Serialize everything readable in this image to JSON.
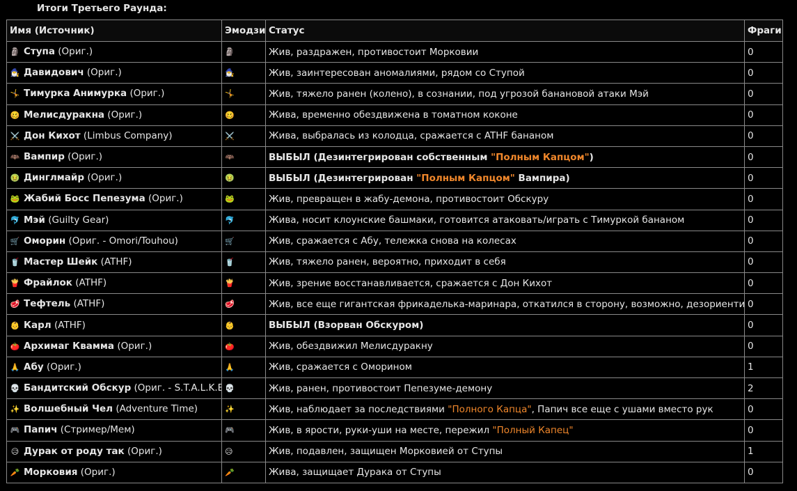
{
  "title": "Итоги Третьего Раунда:",
  "colors": {
    "highlight": "#f0872b",
    "border": "#8a8a8a",
    "background": "#000000",
    "text": "#e6e6e6"
  },
  "headers": {
    "name": "Имя (Источник)",
    "emoji": "Эмодзи",
    "status": "Статус",
    "frags": "Фраги"
  },
  "rows": [
    {
      "emoji": "🗿",
      "name": "Ступа",
      "source": " (Ориг.)",
      "frags": "0",
      "status_parts": [
        {
          "text": "Жив, раздражен, противостоит Морковии",
          "style": ""
        }
      ]
    },
    {
      "emoji": "🧙‍♂️",
      "name": "Давидович",
      "source": " (Ориг.)",
      "frags": "0",
      "status_parts": [
        {
          "text": "Жив, заинтересован аномалиями, рядом со Ступой",
          "style": ""
        }
      ]
    },
    {
      "emoji": "🤸",
      "name": "Тимурка Анимурка",
      "source": " (Ориг.)",
      "frags": "0",
      "status_parts": [
        {
          "text": "Жив, тяжело ранен (колено), в сознании, под угрозой банановой атаки Мэй",
          "style": ""
        }
      ]
    },
    {
      "emoji": "🥴",
      "name": "Мелисдуракна",
      "source": " (Ориг.)",
      "frags": "0",
      "status_parts": [
        {
          "text": "Жива, временно обездвижена в томатном коконе",
          "style": ""
        }
      ]
    },
    {
      "emoji": "⚔️",
      "name": "Дон Кихот",
      "source": " (Limbus Company)",
      "frags": "0",
      "status_parts": [
        {
          "text": "Жива, выбралась из колодца, сражается с ATHF бананом",
          "style": ""
        }
      ]
    },
    {
      "emoji": "🦇",
      "name": "Вампир",
      "source": " (Ориг.)",
      "frags": "0",
      "status_parts": [
        {
          "text": "ВЫБЫЛ (Дезинтегрирован собственным ",
          "style": "bold"
        },
        {
          "text": "\"Полным Капцом\"",
          "style": "hl bold"
        },
        {
          "text": ")",
          "style": "bold"
        }
      ]
    },
    {
      "emoji": "🤢",
      "name": "Динглмайр",
      "source": " (Ориг.)",
      "frags": "0",
      "status_parts": [
        {
          "text": "ВЫБЫЛ (Дезинтегрирован ",
          "style": "bold"
        },
        {
          "text": "\"Полным Капцом\"",
          "style": "hl bold"
        },
        {
          "text": " Вампира)",
          "style": "bold"
        }
      ]
    },
    {
      "emoji": "🐸",
      "name": "Жабий Босс Пепезума",
      "source": " (Ориг.)",
      "frags": "0",
      "status_parts": [
        {
          "text": "Жив, превращен в жабу-демона, противостоит Обскуру",
          "style": ""
        }
      ]
    },
    {
      "emoji": "🐬",
      "name": "Мэй",
      "source": " (Guilty Gear)",
      "frags": "0",
      "status_parts": [
        {
          "text": "Жива, носит клоунские башмаки, готовится атаковать/играть с Тимуркой бананом",
          "style": ""
        }
      ]
    },
    {
      "emoji": "🛒",
      "name": "Оморин",
      "source": " (Ориг. - Omori/Touhou)",
      "frags": "0",
      "status_parts": [
        {
          "text": "Жив, сражается с Абу, тележка снова на колесах",
          "style": ""
        }
      ]
    },
    {
      "emoji": "🥤",
      "name": "Мастер Шейк",
      "source": " (ATHF)",
      "frags": "0",
      "status_parts": [
        {
          "text": "Жив, тяжело ранен, вероятно, приходит в себя",
          "style": ""
        }
      ]
    },
    {
      "emoji": "🍟",
      "name": "Фрайлок",
      "source": " (ATHF)",
      "frags": "0",
      "status_parts": [
        {
          "text": "Жив, зрение восстанавливается, сражается с Дон Кихот",
          "style": ""
        }
      ]
    },
    {
      "emoji": "🥩",
      "name": "Тефтель",
      "source": " (ATHF)",
      "frags": "0",
      "status_parts": [
        {
          "text": "Жив, все еще гигантская фрикаделька-маринара, откатился в сторону, возможно, дезориентирован",
          "style": ""
        }
      ]
    },
    {
      "emoji": "👶",
      "name": "Карл",
      "source": " (ATHF)",
      "frags": "0",
      "status_parts": [
        {
          "text": "ВЫБЫЛ (Взорван Обскуром)",
          "style": "bold"
        }
      ]
    },
    {
      "emoji": "🍅",
      "name": "Архимаг Квамма",
      "source": " (Ориг.)",
      "frags": "0",
      "status_parts": [
        {
          "text": "Жив, обездвижил Мелисдуракну",
          "style": ""
        }
      ]
    },
    {
      "emoji": "🙏",
      "name": "Абу",
      "source": " (Ориг.)",
      "frags": "1",
      "status_parts": [
        {
          "text": "Жив, сражается с Оморином",
          "style": ""
        }
      ]
    },
    {
      "emoji": "💀",
      "name": "Бандитский Обскур",
      "source": " (Ориг. - S.T.A.L.K.E.R.)",
      "frags": "2",
      "status_parts": [
        {
          "text": "Жив, ранен, противостоит Пепезуме-демону",
          "style": ""
        }
      ]
    },
    {
      "emoji": "✨",
      "name": "Волшебный Чел",
      "source": " (Adventure Time)",
      "frags": "0",
      "status_parts": [
        {
          "text": "Жив, наблюдает за последствиями ",
          "style": ""
        },
        {
          "text": "\"Полного Капца\"",
          "style": "hl"
        },
        {
          "text": ", Папич все еще с ушами вместо рук",
          "style": ""
        }
      ]
    },
    {
      "emoji": "🎮",
      "name": "Папич",
      "source": " (Стример/Мем)",
      "frags": "0",
      "status_parts": [
        {
          "text": "Жив, в ярости, руки-уши на месте, пережил ",
          "style": ""
        },
        {
          "text": "\"Полный Капец\"",
          "style": "hl"
        }
      ]
    },
    {
      "emoji": "😥",
      "name": "Дурак от роду так",
      "source": " (Ориг.)",
      "frags": "1",
      "status_parts": [
        {
          "text": "Жив, подавлен, защищен Морковией от Ступы",
          "style": ""
        }
      ]
    },
    {
      "emoji": "🥕",
      "name": "Морковия",
      "source": " (Ориг.)",
      "frags": "0",
      "status_parts": [
        {
          "text": "Жива, защищает Дурака от Ступы",
          "style": ""
        }
      ]
    }
  ]
}
